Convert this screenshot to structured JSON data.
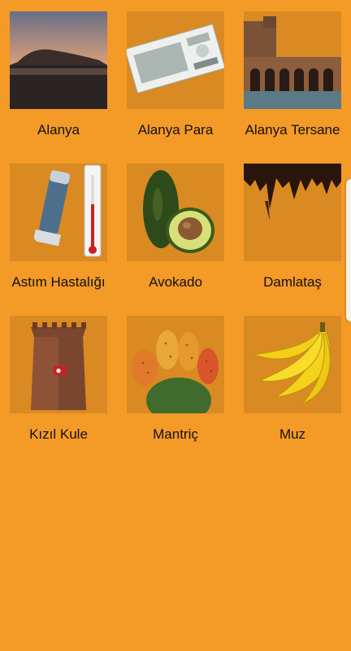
{
  "items": [
    {
      "label": "Alanya",
      "image": "sunset-peninsula-photo"
    },
    {
      "label": "Alanya Para",
      "image": "banknote-photo"
    },
    {
      "label": "Alanya Tersane",
      "image": "shipyard-arches-photo"
    },
    {
      "label": "Astım Hastalığı",
      "image": "inhaler-thermometer-photo"
    },
    {
      "label": "Avokado",
      "image": "avocado-photo"
    },
    {
      "label": "Damlataş",
      "image": "stalactite-cave-photo"
    },
    {
      "label": "Kızıl Kule",
      "image": "red-tower-photo"
    },
    {
      "label": "Mantriç",
      "image": "prickly-pear-photo"
    },
    {
      "label": "Muz",
      "image": "banana-photo"
    }
  ],
  "colors": {
    "background": "#F49A27",
    "tile": "#D98A22"
  }
}
